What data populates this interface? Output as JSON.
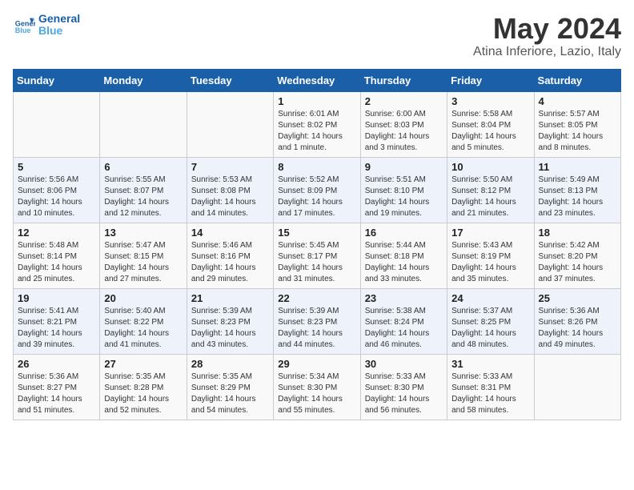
{
  "header": {
    "logo_line1": "General",
    "logo_line2": "Blue",
    "month": "May 2024",
    "location": "Atina Inferiore, Lazio, Italy"
  },
  "weekdays": [
    "Sunday",
    "Monday",
    "Tuesday",
    "Wednesday",
    "Thursday",
    "Friday",
    "Saturday"
  ],
  "weeks": [
    [
      {
        "day": "",
        "text": ""
      },
      {
        "day": "",
        "text": ""
      },
      {
        "day": "",
        "text": ""
      },
      {
        "day": "1",
        "text": "Sunrise: 6:01 AM\nSunset: 8:02 PM\nDaylight: 14 hours\nand 1 minute."
      },
      {
        "day": "2",
        "text": "Sunrise: 6:00 AM\nSunset: 8:03 PM\nDaylight: 14 hours\nand 3 minutes."
      },
      {
        "day": "3",
        "text": "Sunrise: 5:58 AM\nSunset: 8:04 PM\nDaylight: 14 hours\nand 5 minutes."
      },
      {
        "day": "4",
        "text": "Sunrise: 5:57 AM\nSunset: 8:05 PM\nDaylight: 14 hours\nand 8 minutes."
      }
    ],
    [
      {
        "day": "5",
        "text": "Sunrise: 5:56 AM\nSunset: 8:06 PM\nDaylight: 14 hours\nand 10 minutes."
      },
      {
        "day": "6",
        "text": "Sunrise: 5:55 AM\nSunset: 8:07 PM\nDaylight: 14 hours\nand 12 minutes."
      },
      {
        "day": "7",
        "text": "Sunrise: 5:53 AM\nSunset: 8:08 PM\nDaylight: 14 hours\nand 14 minutes."
      },
      {
        "day": "8",
        "text": "Sunrise: 5:52 AM\nSunset: 8:09 PM\nDaylight: 14 hours\nand 17 minutes."
      },
      {
        "day": "9",
        "text": "Sunrise: 5:51 AM\nSunset: 8:10 PM\nDaylight: 14 hours\nand 19 minutes."
      },
      {
        "day": "10",
        "text": "Sunrise: 5:50 AM\nSunset: 8:12 PM\nDaylight: 14 hours\nand 21 minutes."
      },
      {
        "day": "11",
        "text": "Sunrise: 5:49 AM\nSunset: 8:13 PM\nDaylight: 14 hours\nand 23 minutes."
      }
    ],
    [
      {
        "day": "12",
        "text": "Sunrise: 5:48 AM\nSunset: 8:14 PM\nDaylight: 14 hours\nand 25 minutes."
      },
      {
        "day": "13",
        "text": "Sunrise: 5:47 AM\nSunset: 8:15 PM\nDaylight: 14 hours\nand 27 minutes."
      },
      {
        "day": "14",
        "text": "Sunrise: 5:46 AM\nSunset: 8:16 PM\nDaylight: 14 hours\nand 29 minutes."
      },
      {
        "day": "15",
        "text": "Sunrise: 5:45 AM\nSunset: 8:17 PM\nDaylight: 14 hours\nand 31 minutes."
      },
      {
        "day": "16",
        "text": "Sunrise: 5:44 AM\nSunset: 8:18 PM\nDaylight: 14 hours\nand 33 minutes."
      },
      {
        "day": "17",
        "text": "Sunrise: 5:43 AM\nSunset: 8:19 PM\nDaylight: 14 hours\nand 35 minutes."
      },
      {
        "day": "18",
        "text": "Sunrise: 5:42 AM\nSunset: 8:20 PM\nDaylight: 14 hours\nand 37 minutes."
      }
    ],
    [
      {
        "day": "19",
        "text": "Sunrise: 5:41 AM\nSunset: 8:21 PM\nDaylight: 14 hours\nand 39 minutes."
      },
      {
        "day": "20",
        "text": "Sunrise: 5:40 AM\nSunset: 8:22 PM\nDaylight: 14 hours\nand 41 minutes."
      },
      {
        "day": "21",
        "text": "Sunrise: 5:39 AM\nSunset: 8:23 PM\nDaylight: 14 hours\nand 43 minutes."
      },
      {
        "day": "22",
        "text": "Sunrise: 5:39 AM\nSunset: 8:23 PM\nDaylight: 14 hours\nand 44 minutes."
      },
      {
        "day": "23",
        "text": "Sunrise: 5:38 AM\nSunset: 8:24 PM\nDaylight: 14 hours\nand 46 minutes."
      },
      {
        "day": "24",
        "text": "Sunrise: 5:37 AM\nSunset: 8:25 PM\nDaylight: 14 hours\nand 48 minutes."
      },
      {
        "day": "25",
        "text": "Sunrise: 5:36 AM\nSunset: 8:26 PM\nDaylight: 14 hours\nand 49 minutes."
      }
    ],
    [
      {
        "day": "26",
        "text": "Sunrise: 5:36 AM\nSunset: 8:27 PM\nDaylight: 14 hours\nand 51 minutes."
      },
      {
        "day": "27",
        "text": "Sunrise: 5:35 AM\nSunset: 8:28 PM\nDaylight: 14 hours\nand 52 minutes."
      },
      {
        "day": "28",
        "text": "Sunrise: 5:35 AM\nSunset: 8:29 PM\nDaylight: 14 hours\nand 54 minutes."
      },
      {
        "day": "29",
        "text": "Sunrise: 5:34 AM\nSunset: 8:30 PM\nDaylight: 14 hours\nand 55 minutes."
      },
      {
        "day": "30",
        "text": "Sunrise: 5:33 AM\nSunset: 8:30 PM\nDaylight: 14 hours\nand 56 minutes."
      },
      {
        "day": "31",
        "text": "Sunrise: 5:33 AM\nSunset: 8:31 PM\nDaylight: 14 hours\nand 58 minutes."
      },
      {
        "day": "",
        "text": ""
      }
    ]
  ]
}
